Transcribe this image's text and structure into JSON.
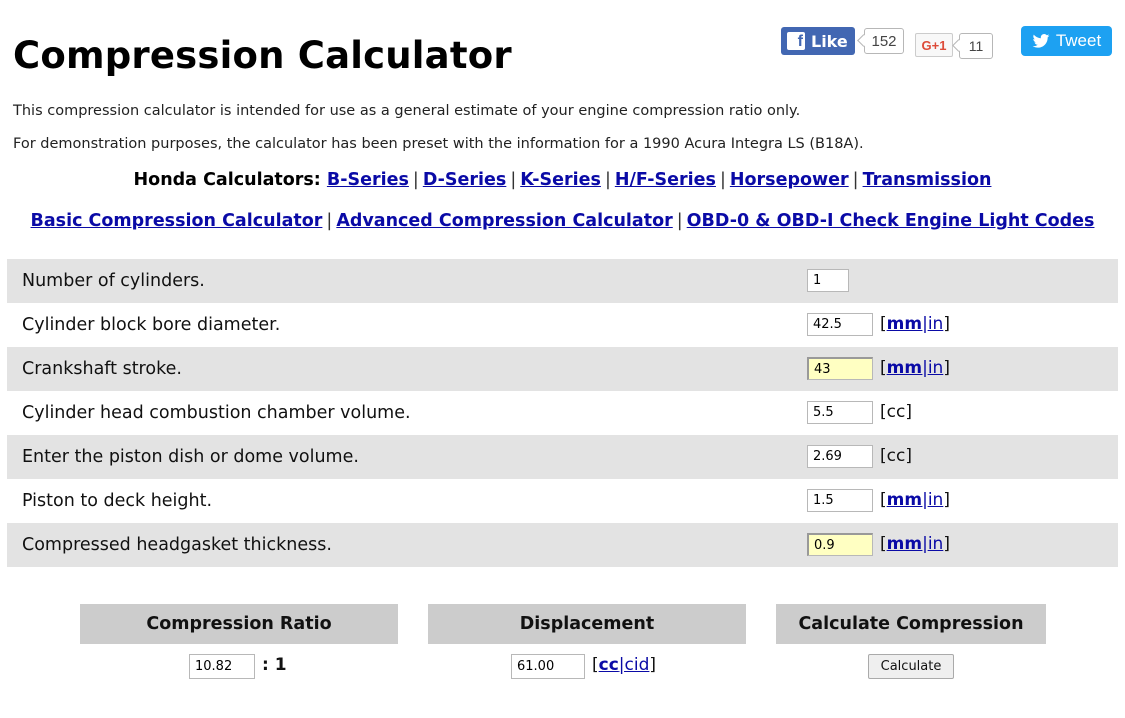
{
  "page": {
    "title": "Compression Calculator",
    "intro1": "This compression calculator is intended for use as a general estimate of your engine compression ratio only.",
    "intro2": "For demonstration purposes, the calculator has been preset with the information for a 1990 Acura Integra LS (B18A)."
  },
  "social": {
    "fb_like_label": "Like",
    "fb_count": "152",
    "gplus_label": "G+1",
    "gplus_count": "11",
    "tweet_label": "Tweet",
    "colors": {
      "facebook": "#4267b2",
      "twitter": "#1da1f2",
      "gplus": "#dd4b39"
    }
  },
  "nav": {
    "honda_label": "Honda Calculators:",
    "honda_links": [
      "B-Series",
      "D-Series",
      "K-Series",
      "H/F-Series",
      "Horsepower",
      "Transmission"
    ],
    "calc_links": [
      "Basic Compression Calculator",
      "Advanced Compression Calculator",
      "OBD-0 & OBD-I Check Engine Light Codes"
    ],
    "separator": "|"
  },
  "form": {
    "rows": [
      {
        "label": "Number of cylinders.",
        "value": "1"
      },
      {
        "label": "Cylinder block bore diameter.",
        "value": "42.5",
        "unit_a": "mm",
        "unit_b": "in"
      },
      {
        "label": "Crankshaft stroke.",
        "value": "43",
        "unit_a": "mm",
        "unit_b": "in"
      },
      {
        "label": "Cylinder head combustion chamber volume.",
        "value": "5.5",
        "unit_text": "[cc]"
      },
      {
        "label": "Enter the piston dish or dome volume.",
        "value": "2.69",
        "unit_text": "[cc]"
      },
      {
        "label": "Piston to deck height.",
        "value": "1.5",
        "unit_a": "mm",
        "unit_b": "in"
      },
      {
        "label": "Compressed headgasket thickness.",
        "value": "0.9",
        "unit_a": "mm",
        "unit_b": "in"
      }
    ]
  },
  "results": {
    "ratio_header": "Compression Ratio",
    "ratio_value": "10.82",
    "ratio_suffix": ": 1",
    "disp_header": "Displacement",
    "disp_value": "61.00",
    "disp_unit_a": "cc",
    "disp_unit_b": "cid",
    "calc_header": "Calculate Compression",
    "calc_button": "Calculate"
  },
  "colors": {
    "link": "#0a0aa6",
    "row_shade": "#e3e3e3",
    "header_box": "#cccccc",
    "highlight_input": "#ffffc2"
  }
}
